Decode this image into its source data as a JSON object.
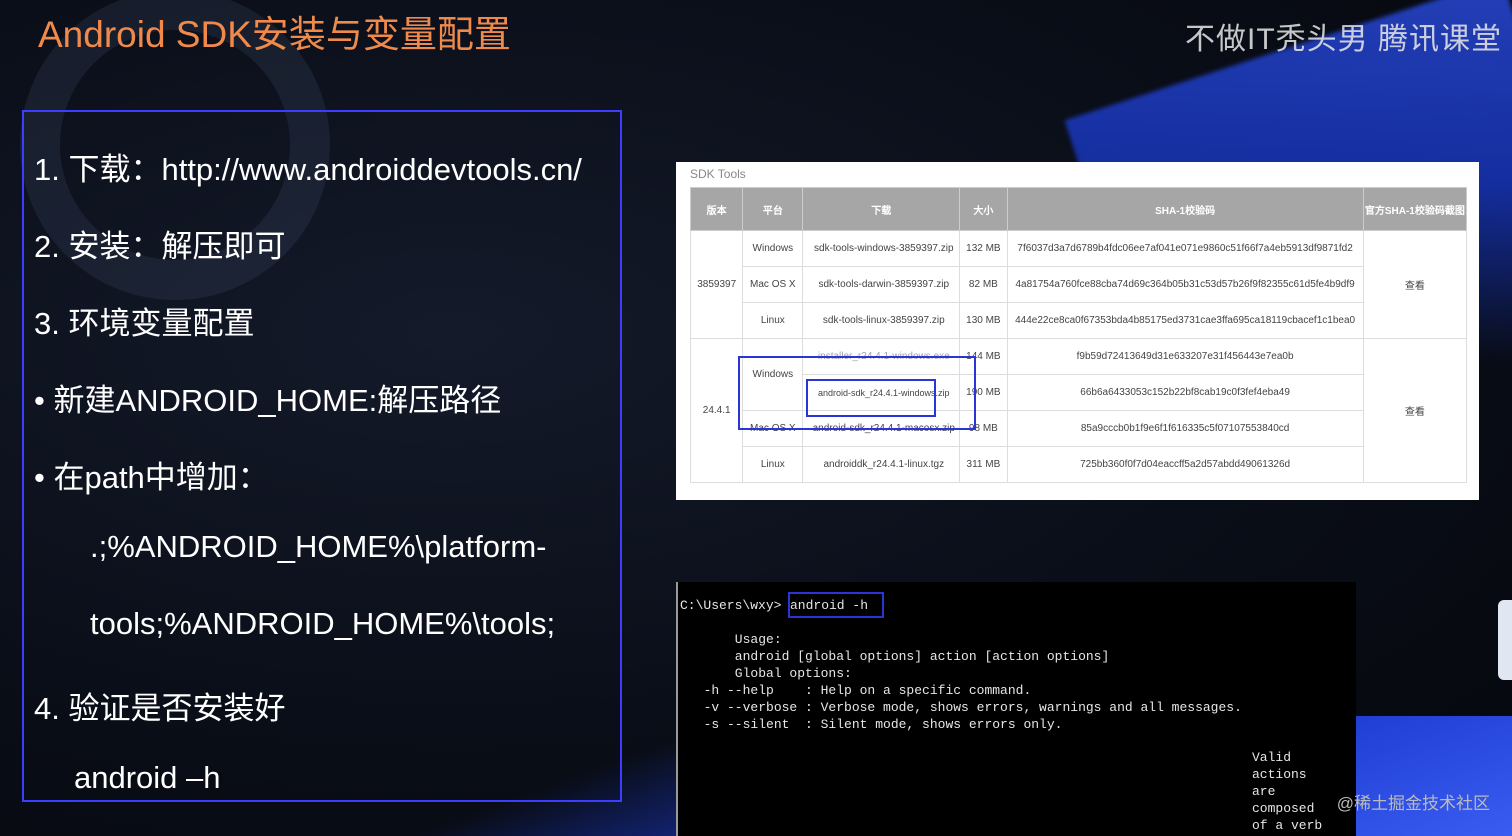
{
  "slide": {
    "title": "Android SDK安装与变量配置",
    "watermark": "不做IT秃头男 腾讯课堂",
    "corner_watermark": "@稀土掘金技术社区"
  },
  "steps": [
    "1.  下载：http://www.androiddevtools.cn/",
    "2.  安装：解压即可",
    "3.    环境变量配置",
    "•     新建ANDROID_HOME:解压路径",
    "•     在path中增加：",
    ".;%ANDROID_HOME%\\platform-",
    "tools;%ANDROID_HOME%\\tools;",
    "4.    验证是否安装好",
    "android –h"
  ],
  "sdk_table": {
    "title": "SDK Tools",
    "headers": [
      "版本",
      "平台",
      "下载",
      "大小",
      "SHA-1校验码",
      "官方SHA-1校验码截图"
    ],
    "groups": [
      {
        "version": "3859397",
        "check": "查看",
        "rows": [
          {
            "platform": "Windows",
            "file": "sdk-tools-windows-3859397.zip",
            "size": "132 MB",
            "sha": "7f6037d3a7d6789b4fdc06ee7af041e071e9860c51f66f7a4eb5913df9871fd2"
          },
          {
            "platform": "Mac OS X",
            "file": "sdk-tools-darwin-3859397.zip",
            "size": "82 MB",
            "sha": "4a81754a760fce88cba74d69c364b05b31c53d57b26f9f82355c61d5fe4b9df9"
          },
          {
            "platform": "Linux",
            "file": "sdk-tools-linux-3859397.zip",
            "size": "130 MB",
            "sha": "444e22ce8ca0f67353bda4b85175ed3731cae3ffa695ca18119cbacef1c1bea0"
          }
        ]
      },
      {
        "version": "24.4.1",
        "check": "查看",
        "rows": [
          {
            "platform": "Windows",
            "file": "installer_r24.4.1-windows.exe",
            "size": "144 MB",
            "sha": "f9b59d72413649d31e633207e31f456443e7ea0b"
          },
          {
            "platform": "",
            "file": "android-sdk_r24.4.1-windows.zip",
            "size": "190 MB",
            "sha": "66b6a6433053c152b22bf8cab19c0f3fef4eba49"
          },
          {
            "platform": "Mac OS X",
            "file": "android-sdk_r24.4.1-macosx.zip",
            "size": "98 MB",
            "sha": "85a9cccb0b1f9e6f1f616335c5f07107553840cd"
          },
          {
            "platform": "Linux",
            "file": "androiddk_r24.4.1-linux.tgz",
            "size": "311 MB",
            "sha": "725bb360f0f7d04eaccff5a2d57abdd49061326d"
          }
        ]
      }
    ]
  },
  "terminal": {
    "prompt": "C:\\Users\\wxy>",
    "command": "android -h",
    "lines": [
      "      Usage:",
      "      android [global options] action [action options]",
      "      Global options:",
      "  -h --help    : Help on a specific command.",
      "  -v --verbose : Verbose mode, shows errors, warnings and all messages.",
      "  -s --silent  : Silent mode, shows errors only."
    ],
    "right_col": [
      "Valid",
      "actions",
      "are",
      "composed",
      "of a verb"
    ]
  }
}
